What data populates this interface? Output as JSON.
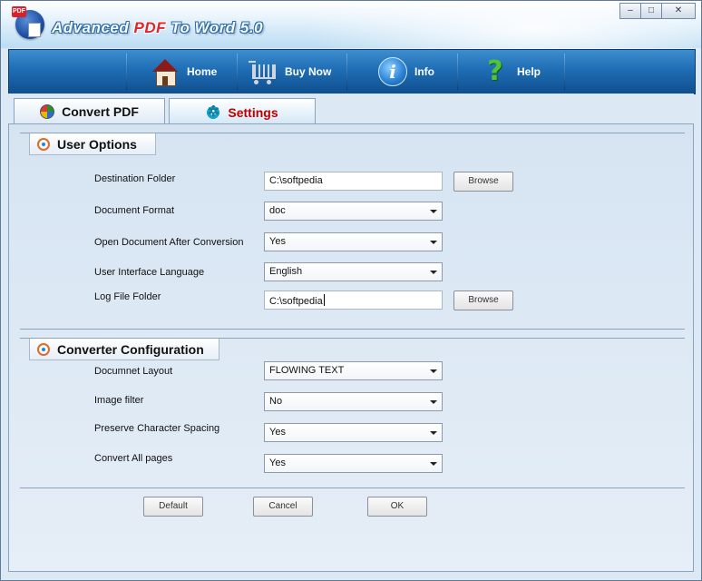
{
  "window": {
    "title_prefix": "Advanced ",
    "title_pdf": "PDF",
    "title_suffix": " To Word 5.0",
    "minimize_glyph": "–",
    "maximize_glyph": "□",
    "close_glyph": "✕"
  },
  "toolbar": {
    "items": [
      {
        "label": "Home",
        "icon": "home-icon"
      },
      {
        "label": "Buy Now",
        "icon": "shopping-cart-icon"
      },
      {
        "label": "Info",
        "icon": "info-icon"
      },
      {
        "label": "Help",
        "icon": "help-icon"
      }
    ]
  },
  "tabs": [
    {
      "label": "Convert PDF",
      "active": false
    },
    {
      "label": "Settings",
      "active": true
    }
  ],
  "user_options": {
    "title": "User Options",
    "destination_folder": {
      "label": "Destination Folder",
      "value": "C:\\softpedia",
      "button": "Browse"
    },
    "document_format": {
      "label": "Document Format",
      "value": "doc"
    },
    "open_after": {
      "label": "Open Document After Conversion",
      "value": "Yes"
    },
    "ui_language": {
      "label": "User Interface Language",
      "value": "English"
    },
    "log_folder": {
      "label": "Log File Folder",
      "value": "C:\\softpedia",
      "button": "Browse"
    }
  },
  "converter_config": {
    "title": "Converter Configuration",
    "layout": {
      "label": "Documnet Layout",
      "value": "FLOWING TEXT"
    },
    "image_filter": {
      "label": "Image filter",
      "value": "No"
    },
    "char_spacing": {
      "label": "Preserve Character Spacing",
      "value": "Yes"
    },
    "all_pages": {
      "label": "Convert All pages",
      "value": "Yes"
    }
  },
  "footer": {
    "default_label": "Default",
    "cancel_label": "Cancel",
    "ok_label": "OK"
  },
  "colors": {
    "toolbar_blue": "#1f6db4",
    "active_tab_text": "#c00000",
    "pdf_red": "#e0242a"
  }
}
